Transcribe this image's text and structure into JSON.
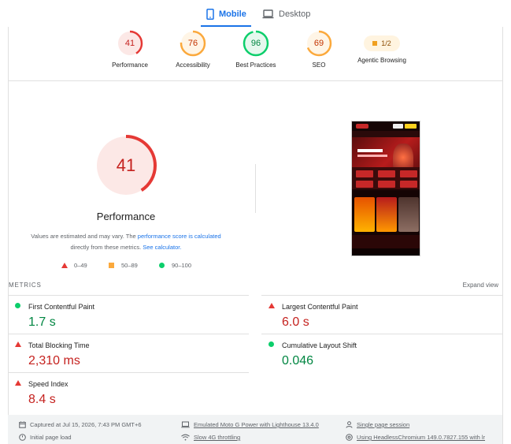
{
  "tabs": {
    "mobile_label": "Mobile",
    "desktop_label": "Desktop"
  },
  "summary": {
    "gauges": [
      {
        "score": "41",
        "label": "Performance",
        "status": "bad",
        "color": "#e53935"
      },
      {
        "score": "76",
        "label": "Accessibility",
        "status": "average",
        "color": "#fba93c"
      },
      {
        "score": "96",
        "label": "Best Practices",
        "status": "good",
        "color": "#0cce6b"
      },
      {
        "score": "69",
        "label": "SEO",
        "status": "average",
        "color": "#fba93c"
      }
    ],
    "agentic": {
      "badge": "1/2",
      "label": "Agentic Browsing"
    }
  },
  "performance": {
    "score": "41",
    "score_fraction": 0.41,
    "title": "Performance",
    "note_prefix": "Values are estimated and may vary. The",
    "note_link1": "performance score is calculated",
    "note_middle": "directly from these metrics.",
    "note_link2": "See calculator.",
    "legend": {
      "bad": "0–49",
      "average": "50–89",
      "good": "90–100"
    }
  },
  "metrics": {
    "title": "METRICS",
    "expand_label": "Expand view",
    "items": [
      {
        "name": "First Contentful Paint",
        "value": "1.7 s",
        "status": "good"
      },
      {
        "name": "Largest Contentful Paint",
        "value": "6.0 s",
        "status": "bad"
      },
      {
        "name": "Total Blocking Time",
        "value": "2,310 ms",
        "status": "bad"
      },
      {
        "name": "Cumulative Layout Shift",
        "value": "0.046",
        "status": "good"
      },
      {
        "name": "Speed Index",
        "value": "8.4 s",
        "status": "bad"
      }
    ]
  },
  "info": {
    "captured": "Captured at Jul 15, 2026, 7:43 PM GMT+6",
    "device": "Emulated Moto G Power with Lighthouse 13.4.0",
    "session": "Single page session",
    "load": "Initial page load",
    "throttling": "Slow 4G throttling",
    "browser": "Using HeadlessChromium 149.0.7827.155 with lr"
  },
  "colors": {
    "accent": "#1a73e8",
    "bad": "#e53935",
    "average": "#fba93c",
    "good": "#0cce6b"
  }
}
